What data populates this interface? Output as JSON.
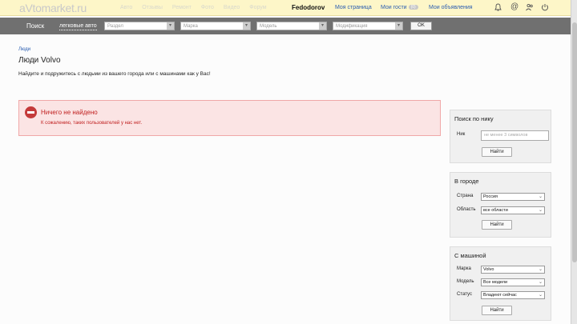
{
  "header": {
    "logo": "aVtomarket.ru",
    "ghost_links": [
      "Авто",
      "Отзывы",
      "Ремонт",
      "Фото",
      "Видео",
      "Форум"
    ],
    "username": "Fedodorov",
    "my_page": "Моя страница",
    "my_guests": "Мои гости",
    "guests_badge": "(0)",
    "my_ads": "Мои объявления"
  },
  "searchbar": {
    "label": "Поиск",
    "category": "легковые авто",
    "section_placeholder": "Раздел",
    "brand_placeholder": "Марка",
    "model_placeholder": "Модель",
    "modification_placeholder": "Модификация",
    "ok_label": "OK"
  },
  "main": {
    "breadcrumb": "Люди",
    "title": "Люди Volvo",
    "description": "Найдите и подружитесь с людьми из вашего города или с машинами как у Вас!",
    "alert_title": "Ничего не найдено",
    "alert_text": "К сожалению, таких пользователей у нас нет."
  },
  "sidebar": {
    "nick": {
      "title": "Поиск по нику",
      "label": "Ник",
      "placeholder": "не менее 3 символов",
      "button": "Найти"
    },
    "city": {
      "title": "В городе",
      "country_label": "Страна",
      "country_value": "Россия",
      "region_label": "Область",
      "region_value": "все области",
      "button": "Найти"
    },
    "car": {
      "title": "С машиной",
      "brand_label": "Марка",
      "brand_value": "Volvo",
      "model_label": "Модель",
      "model_value": "Все модели",
      "status_label": "Статус",
      "status_value": "Владеют сейчас",
      "button": "Найти"
    }
  },
  "colors": {
    "topbar": "#fdf6c8",
    "searchbar": "#707070",
    "alert_bg": "#fbe4e4",
    "alert_text": "#c02020",
    "link": "#2a5db0"
  }
}
